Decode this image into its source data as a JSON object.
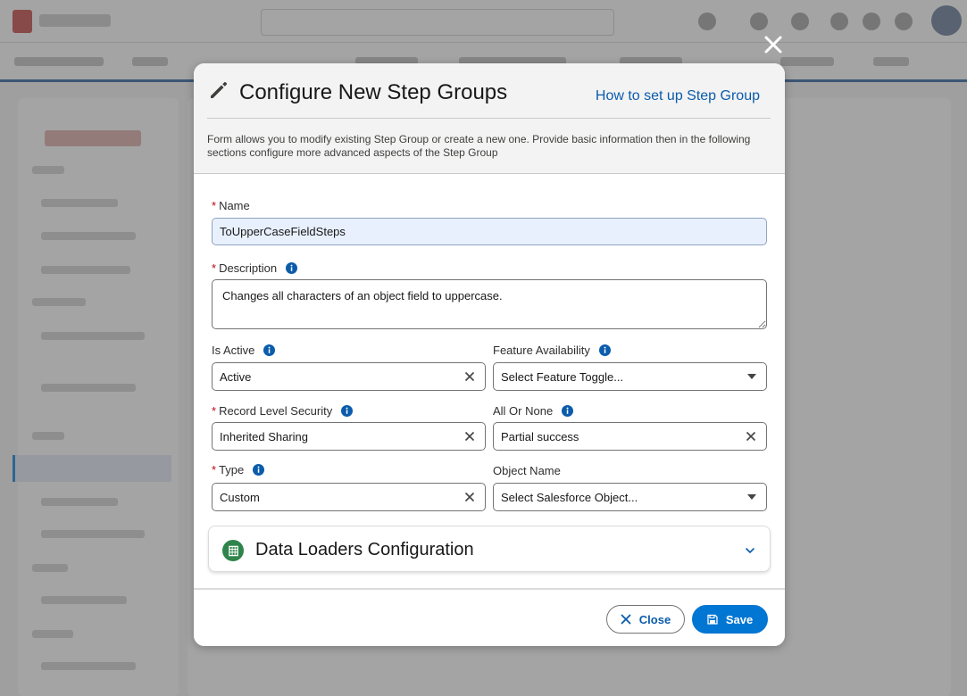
{
  "modal": {
    "title": "Configure New Step Groups",
    "help_link": "How to set up Step Group",
    "description": "Form allows you to modify existing Step Group or create a new one. Provide basic information then in the following sections configure more advanced aspects of the Step Group"
  },
  "form": {
    "required_marker": "*",
    "name": {
      "label": "Name",
      "value": "ToUpperCaseFieldSteps"
    },
    "description": {
      "label": "Description",
      "value": "Changes all characters of an object field to uppercase."
    },
    "is_active": {
      "label": "Is Active",
      "value": "Active"
    },
    "feature_availability": {
      "label": "Feature Availability",
      "placeholder": "Select Feature Toggle..."
    },
    "record_level_security": {
      "label": "Record Level Security",
      "value": "Inherited Sharing"
    },
    "all_or_none": {
      "label": "All Or None",
      "value": "Partial success"
    },
    "type": {
      "label": "Type",
      "value": "Custom"
    },
    "object_name": {
      "label": "Object Name",
      "placeholder": "Select Salesforce Object..."
    }
  },
  "accordion": {
    "title": "Data Loaders Configuration",
    "icon": "spreadsheet-icon"
  },
  "footer": {
    "close_label": "Close",
    "save_label": "Save"
  },
  "colors": {
    "brand": "#0176d3",
    "link": "#0b5cab",
    "required": "#ba0517",
    "accordion_icon": "#2e844a"
  }
}
